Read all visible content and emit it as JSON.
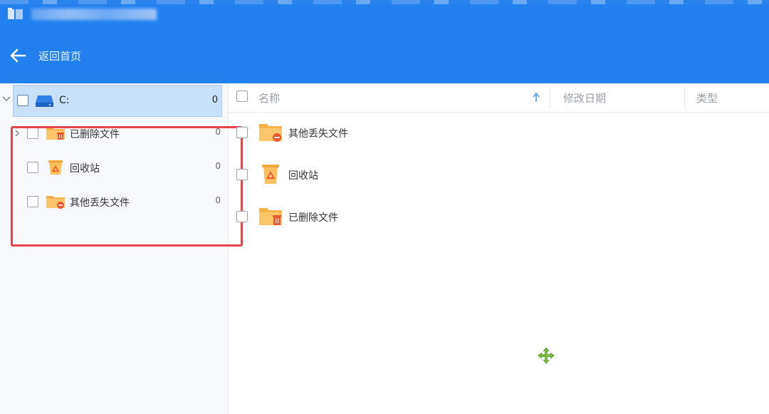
{
  "header": {
    "back_label": "返回首页"
  },
  "colors": {
    "header_bg": "#2380ef",
    "folder": "#fbbf5b",
    "highlight_border": "#e5464d",
    "selected_row": "#c9e0fa"
  },
  "sidebar": {
    "drive": {
      "label": "C:",
      "count": "0",
      "icon": "hard-drive-icon"
    },
    "items": [
      {
        "label": "已删除文件",
        "count": "0",
        "icon": "deleted-folder-icon",
        "expandable": true
      },
      {
        "label": "回收站",
        "count": "0",
        "icon": "recycle-bin-icon",
        "expandable": false
      },
      {
        "label": "其他丢失文件",
        "count": "0",
        "icon": "lost-folder-icon",
        "expandable": false
      }
    ]
  },
  "columns": {
    "name": "名称",
    "modified": "修改日期",
    "type": "类型",
    "sort": "ascending"
  },
  "files": [
    {
      "label": "其他丢失文件",
      "icon": "lost-folder-icon"
    },
    {
      "label": "回收站",
      "icon": "recycle-bin-icon"
    },
    {
      "label": "已删除文件",
      "icon": "deleted-folder-icon"
    }
  ]
}
